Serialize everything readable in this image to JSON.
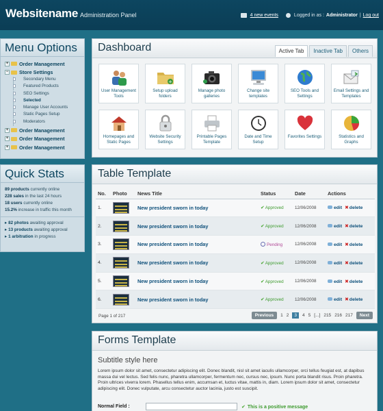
{
  "header": {
    "site_name": "Websitename",
    "site_sub": "Administration Panel",
    "events_link": "4 new events",
    "logged_in_label": "Logged in as :",
    "user": "Administrator",
    "logout": "Log out"
  },
  "menu": {
    "title": "Menu Options",
    "items": [
      {
        "label": "Order Management"
      },
      {
        "label": "Store Settings"
      },
      {
        "label": "Order Management"
      },
      {
        "label": "Order Management"
      },
      {
        "label": "Order Management"
      }
    ],
    "subitems": [
      "Secondary Menu",
      "Featured Products",
      "SEO Settings",
      "Selected",
      "Manage User Accounts",
      "Static Pages Setup",
      "Moderators"
    ]
  },
  "quick_stats": {
    "title": "Quick Stats",
    "stats": [
      {
        "value": "89 products",
        "text": "currently online"
      },
      {
        "value": "228 sales",
        "text": "in the last 24 hours"
      },
      {
        "value": "18 users",
        "text": "currently online"
      },
      {
        "value": "15.2%",
        "text": "increase in traffic this month"
      }
    ],
    "pending": [
      {
        "value": "82 photos",
        "text": "awaiting approval"
      },
      {
        "value": "13 products",
        "text": "awaiting approval"
      },
      {
        "value": "1 arbitration",
        "text": "in progress"
      }
    ]
  },
  "dashboard": {
    "title": "Dashboard",
    "tabs": [
      "Active Tab",
      "Inactive Tab",
      "Others"
    ],
    "tiles": [
      {
        "label": "User Management Tools",
        "icon": "users-icon"
      },
      {
        "label": "Setup upload folders",
        "icon": "folder-icon"
      },
      {
        "label": "Manage photo galleries",
        "icon": "camera-icon"
      },
      {
        "label": "Change site templates",
        "icon": "monitor-icon"
      },
      {
        "label": "SEO Tools and Settings",
        "icon": "globe-icon"
      },
      {
        "label": "Email Settings and Templates",
        "icon": "email-icon"
      },
      {
        "label": "Homepages and Static Pages",
        "icon": "home-icon"
      },
      {
        "label": "Website Security Settings",
        "icon": "lock-icon"
      },
      {
        "label": "Printable Pages Template",
        "icon": "printer-icon"
      },
      {
        "label": "Date and Time Setup",
        "icon": "clock-icon"
      },
      {
        "label": "Favorites Settings",
        "icon": "heart-icon"
      },
      {
        "label": "Statistics and Graphs",
        "icon": "pie-chart-icon"
      }
    ]
  },
  "table": {
    "title": "Table Template",
    "columns": [
      "No.",
      "Photo",
      "News Title",
      "Status",
      "Date",
      "Actions"
    ],
    "rows": [
      {
        "no": "1.",
        "title": "New president sworn in today",
        "status": "Approved",
        "date": "12/06/2008"
      },
      {
        "no": "2.",
        "title": "New president sworn in today",
        "status": "Approved",
        "date": "12/06/2008"
      },
      {
        "no": "3.",
        "title": "New president sworn in today",
        "status": "Pending",
        "date": "12/06/2008"
      },
      {
        "no": "4.",
        "title": "New president sworn in today",
        "status": "Approved",
        "date": "12/06/2008"
      },
      {
        "no": "5.",
        "title": "New president sworn in today",
        "status": "Approved",
        "date": "12/06/2008"
      },
      {
        "no": "6.",
        "title": "New president sworn in today",
        "status": "Approved",
        "date": "12/06/2008"
      }
    ],
    "edit_label": "edit",
    "delete_label": "delete",
    "page_info": "Page 1 of 217",
    "pager": {
      "previous": "Previous",
      "pages": [
        "1",
        "2",
        "3",
        "4",
        "5",
        "[...]",
        "215",
        "216",
        "217"
      ],
      "current": "3",
      "next": "Next"
    }
  },
  "forms": {
    "title": "Forms Template",
    "subtitle": "Subtitle style here",
    "lorem": "Lorem ipsum dolor sit amet, consectetur adipiscing elit. Donec blandit, nisl sit amet iaculis ullamcorper, orci tellus feugiat est, at dapibus massa dui vel lectus. Sed felis nunc, pharetra ullamcorper, fermentum nec, cursus nec, ipsum. Nunc porta blandit risus. Proin pharetra. Proin ultrices viverra lorem. Phasellus tellus enim, accumsan et, luctus vitae, mattis in, diam. Lorem ipsum dolor sit amet, consectetur adipiscing elit. Donec vulputate, arcu consectetur auctor lacinia, justo est suscipit.",
    "field_label": "Normal Field :",
    "field_value": "",
    "message": "This is a positive message"
  }
}
